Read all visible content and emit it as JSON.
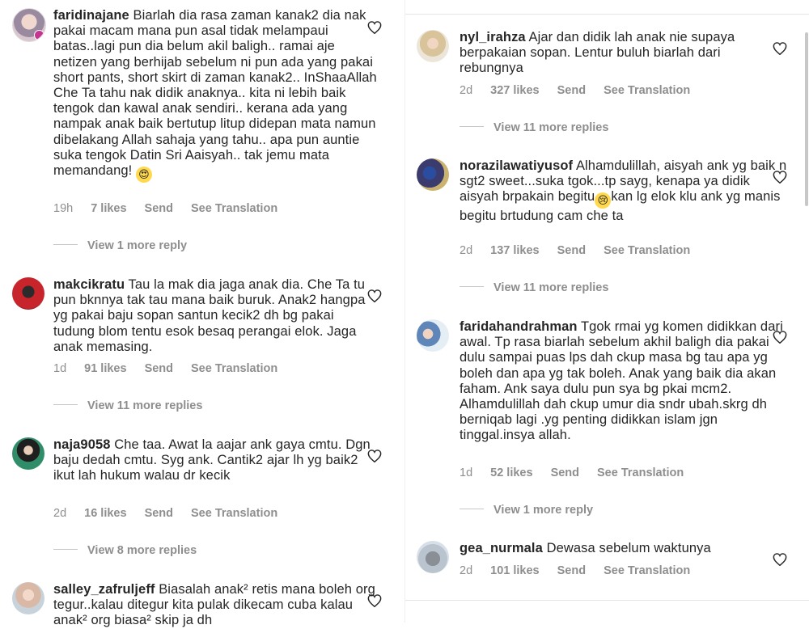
{
  "left": [
    {
      "username": "faridinajane",
      "text": "Biarlah dia rasa zaman kanak2 dia nak pakai macam mana pun asal tidak melampaui batas..lagi pun dia belum akil baligh.. ramai aje netizen yang berhijab sebelum ni pun ada yang pakai short pants, short skirt di zaman kanak2.. InShaaAllah Che Ta tahu nak didik anaknya.. kita ni lebih baik tengok dan kawal anak sendiri.. kerana ada yang nampak anak baik bertutup litup didepan mata namun dibelakang Allah sahaja yang tahu.. apa pun auntie suka tengok Datin Sri Aaisyah.. tak jemu mata memandang!",
      "emoji": "😍",
      "time": "19h",
      "likes": "7 likes",
      "send": "Send",
      "translate": "See Translation",
      "replies": "View 1 more reply"
    },
    {
      "username": "makcikratu",
      "text": "Tau la mak dia jaga anak dia. Che Ta tu pun bknnya tak tau mana baik buruk. Anak2 hangpa yg pakai baju sopan santun kecik2 dh bg pakai tudung blom tentu esok besaq perangai elok. Jaga anak memasing.",
      "time": "1d",
      "likes": "91 likes",
      "send": "Send",
      "translate": "See Translation",
      "replies": "View 11 more replies"
    },
    {
      "username": "naja9058",
      "text": "Che taa.  Awat la aajar ank gaya cmtu.  Dgn baju dedah cmtu.  Syg ank. Cantik2 ajar lh yg baik2 ikut lah hukum walau dr kecik",
      "time": "2d",
      "likes": "16 likes",
      "send": "Send",
      "translate": "See Translation",
      "replies": "View 8 more replies"
    },
    {
      "username": "salley_zafruljeff",
      "text": "Biasalah anak² retis mana boleh org tegur..kalau ditegur kita pulak dikecam cuba kalau anak² org biasa² skip ja dh"
    }
  ],
  "right": [
    {
      "username": "nyl_irahza",
      "text": "Ajar dan didik lah anak nie supaya berpakaian sopan. Lentur buluh biarlah dari rebungnya",
      "time": "2d",
      "likes": "327 likes",
      "send": "Send",
      "translate": "See Translation",
      "replies": "View 11 more replies"
    },
    {
      "username": "norazilawatiyusof",
      "text": "Alhamdulillah, aisyah ank yg baik n sgt2 sweet...suka tgok...tp sayg, kenapa ya didik aisyah brpakain begitu",
      "emoji": "😢",
      "text2": "kan lg elok klu ank yg manis begitu brtudung cam che ta",
      "time": "2d",
      "likes": "137 likes",
      "send": "Send",
      "translate": "See Translation",
      "replies": "View 11 more replies"
    },
    {
      "username": "faridahandrahman",
      "text": "Tgok rmai yg komen didikkan dari awal. Tp rasa biarlah sebelum akhil baligh dia pakai dulu sampai puas lps dah ckup masa bg tau apa yg boleh dan apa yg tak boleh. Anak yang baik dia akan faham. Ank saya dulu pun sya bg pkai mcm2. Alhamdulillah dah ckup umur dia sndr ubah.skrg dh berniqab lagi .yg penting didikkan islam jgn tinggal.insya allah.",
      "time": "1d",
      "likes": "52 likes",
      "send": "Send",
      "translate": "See Translation",
      "replies": "View 1 more reply"
    },
    {
      "username": "gea_nurmala",
      "text": "Dewasa sebelum waktunya",
      "time": "2d",
      "likes": "101 likes",
      "send": "Send",
      "translate": "See Translation"
    }
  ],
  "icons": {
    "like": "heart-outline-icon"
  },
  "colors": {
    "text": "#262626",
    "meta": "#8e8e8e",
    "divider": "#e6e6e6"
  }
}
